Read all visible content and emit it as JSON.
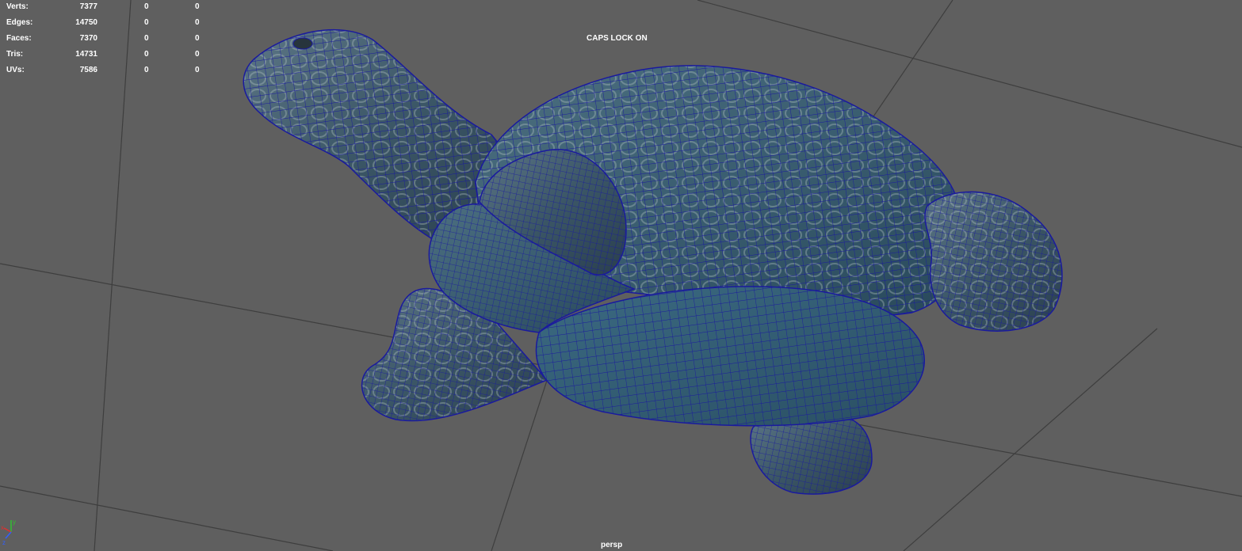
{
  "hud": {
    "rows": [
      {
        "label": "Verts:",
        "total": "7377",
        "selected": "0",
        "components": "0"
      },
      {
        "label": "Edges:",
        "total": "14750",
        "selected": "0",
        "components": "0"
      },
      {
        "label": "Faces:",
        "total": "7370",
        "selected": "0",
        "components": "0"
      },
      {
        "label": "Tris:",
        "total": "14731",
        "selected": "0",
        "components": "0"
      },
      {
        "label": "UVs:",
        "total": "7586",
        "selected": "0",
        "components": "0"
      }
    ]
  },
  "viewport": {
    "caps_lock_text": "CAPS LOCK ON",
    "camera_name": "persp",
    "background_color": "#5f5f5f",
    "grid_color": "#3e3e3e",
    "wireframe_color": "#1a1a9e",
    "model_name_icon": "turtle-mesh"
  },
  "axis_gizmo": {
    "x_label": "x",
    "y_label": "y",
    "z_label": "z",
    "x_color": "#e03030",
    "y_color": "#30c030",
    "z_color": "#3060ff"
  }
}
